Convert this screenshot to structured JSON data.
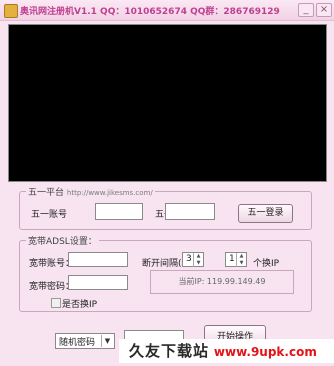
{
  "window": {
    "title": "奥讯网注册机V1.1   QQ：1010652674 QQ群：286769129",
    "minimize_icon": "minimize-icon",
    "close_icon": "close-icon",
    "close_glyph": "×",
    "minimize_glyph": "_"
  },
  "group_51": {
    "title": "五一平台",
    "url": "http://www.jikesms.com/",
    "account_label": "五一账号",
    "account_value": "",
    "password_label": "五一密码",
    "password_value": "",
    "login_button": "五一登录"
  },
  "group_adsl": {
    "title": "宽带ADSL设置：",
    "account_label": "宽带账号：",
    "account_value": "",
    "password_label": "宽带密码：",
    "password_value": "",
    "interval_label": "断开间隔(秒)：",
    "interval_value": "3",
    "per_value": "1",
    "per_label": "个换IP",
    "current_ip": "当前IP: 119.99.149.49",
    "change_ip_label": "是否换IP",
    "change_ip_checked": false
  },
  "bottom": {
    "password_mode_selected": "随机密码",
    "password_input_value": "",
    "start_button": "开始操作"
  },
  "watermark": {
    "cn_text": "久友下载站",
    "url_text": "www.9upk.com"
  }
}
